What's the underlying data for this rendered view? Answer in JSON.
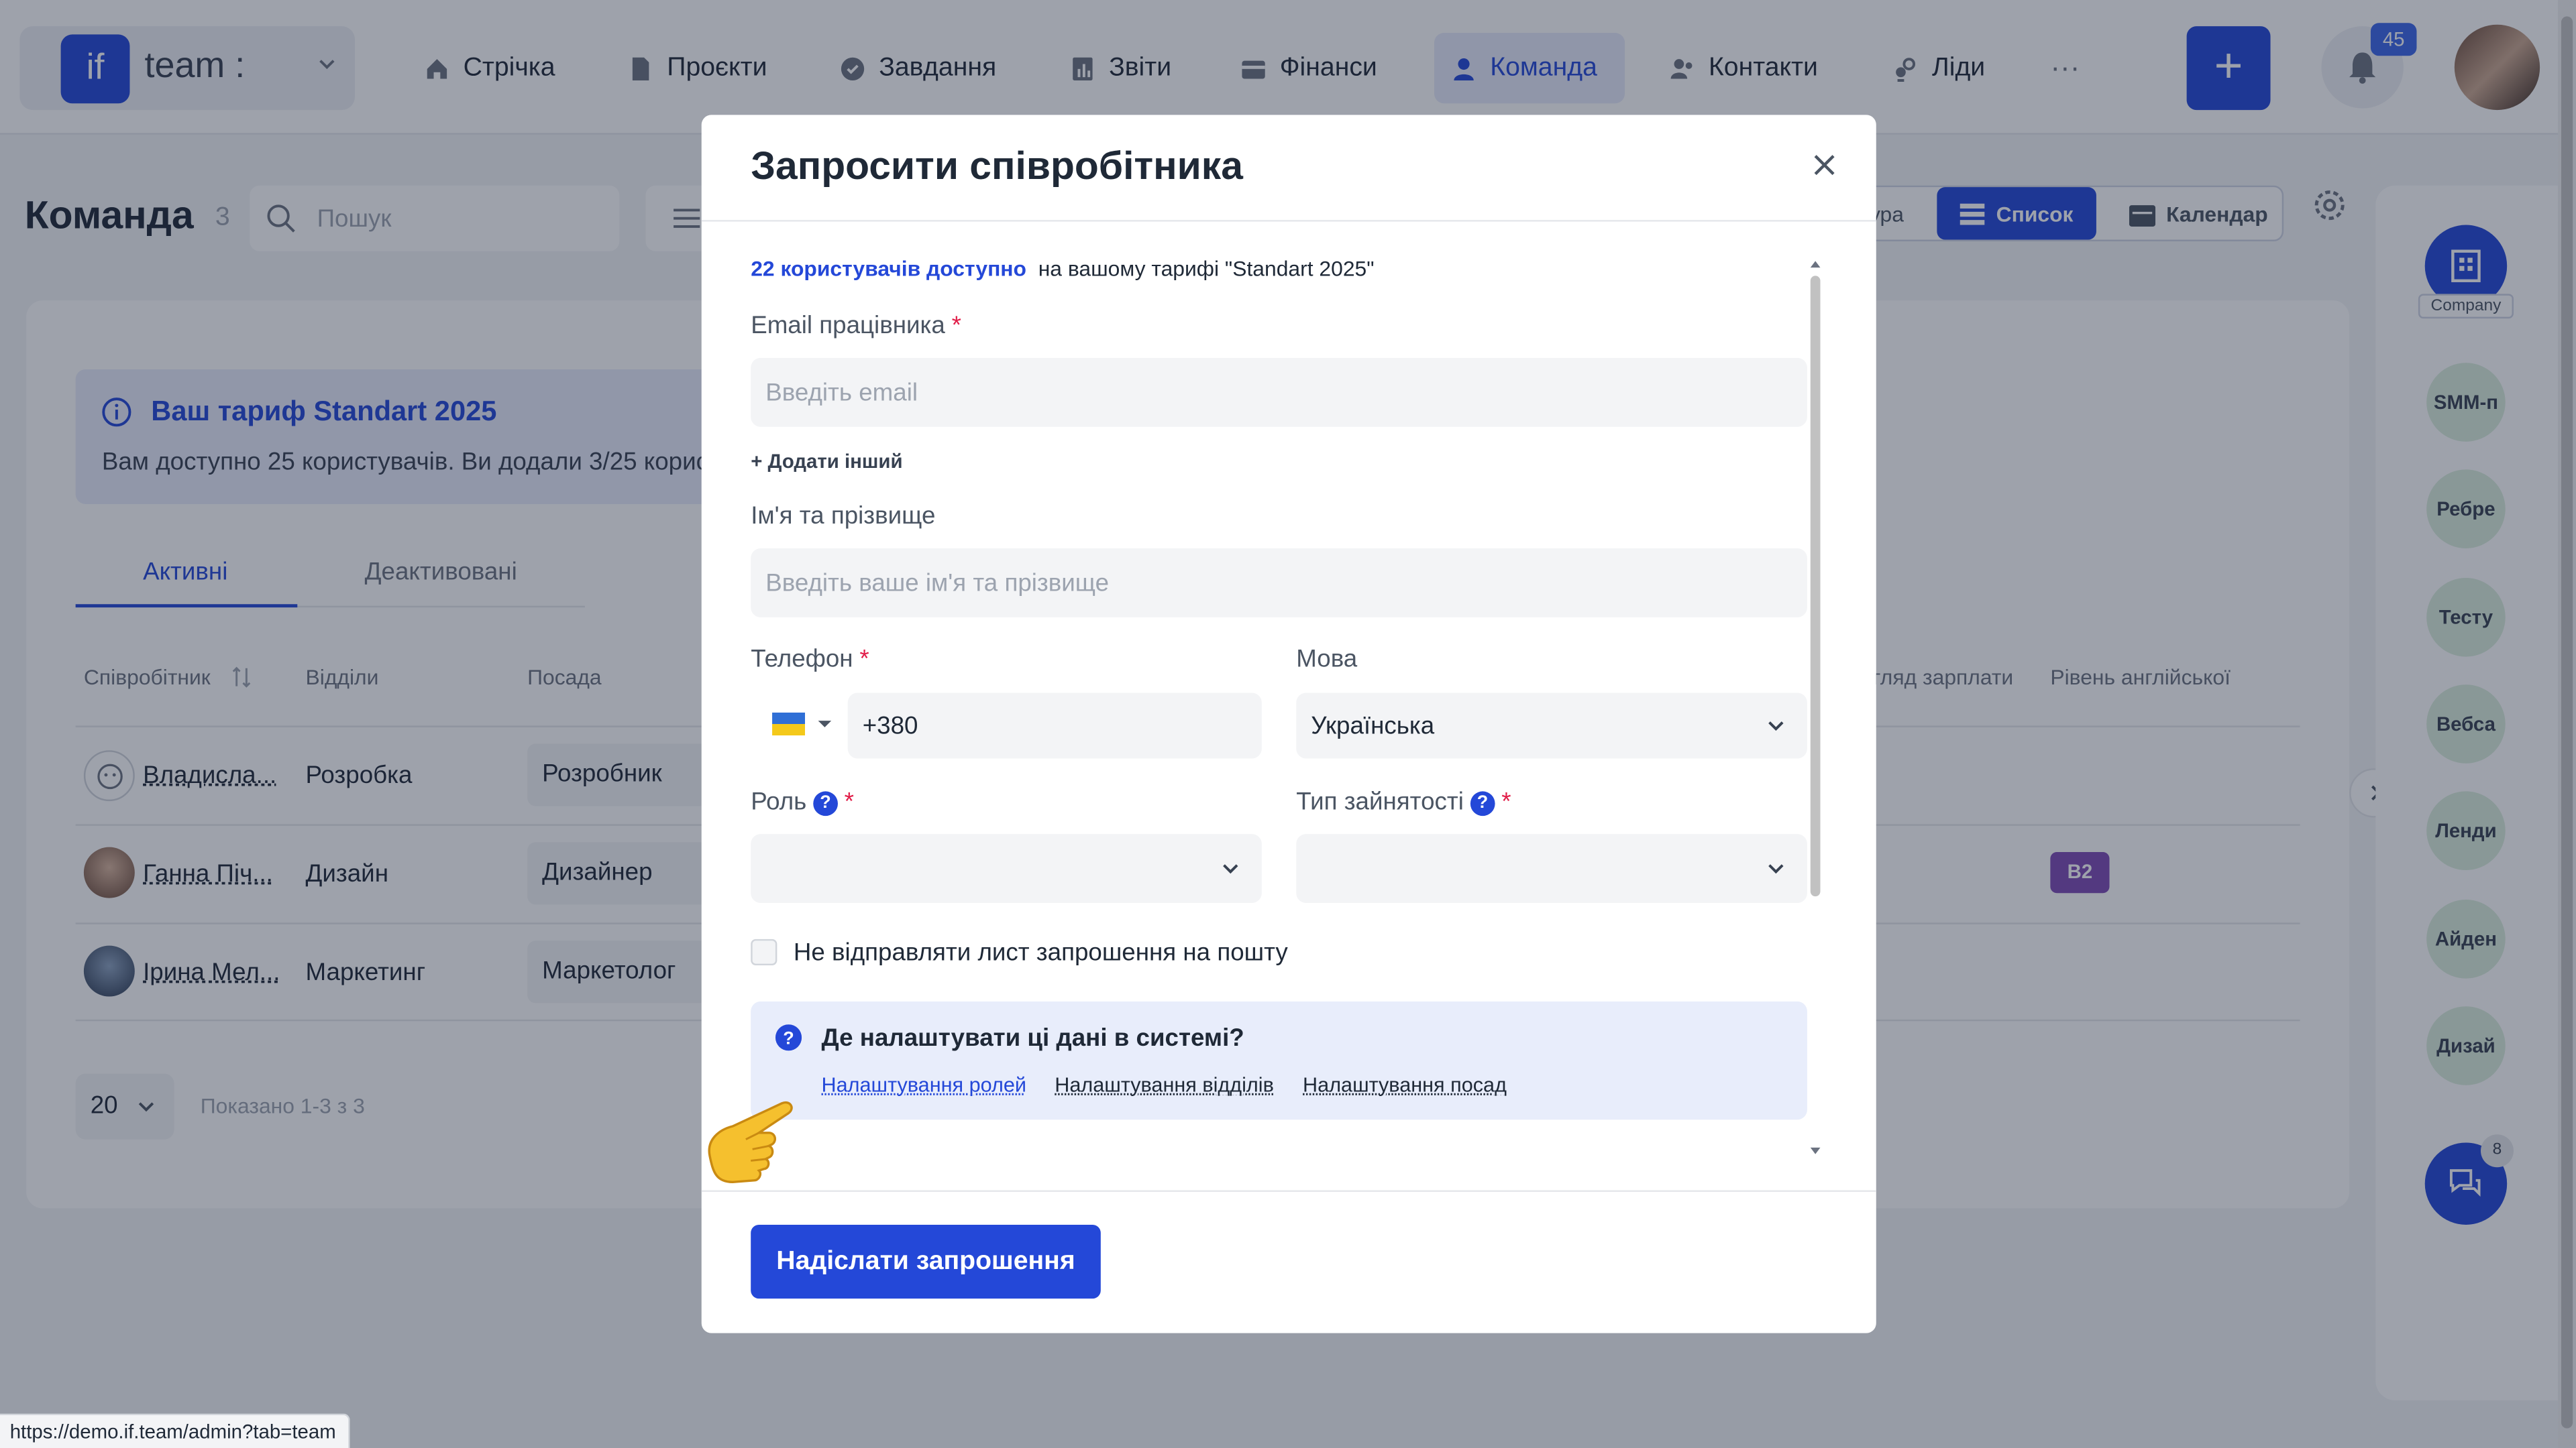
{
  "logo": {
    "mark": "if",
    "text": "team :"
  },
  "nav": [
    {
      "label": "Стрічка",
      "icon": "home-icon",
      "active": false
    },
    {
      "label": "Проєкти",
      "icon": "file-icon",
      "active": false
    },
    {
      "label": "Завдання",
      "icon": "check-circle-icon",
      "active": false
    },
    {
      "label": "Звіти",
      "icon": "report-icon",
      "active": false
    },
    {
      "label": "Фінанси",
      "icon": "wallet-icon",
      "active": false
    },
    {
      "label": "Команда",
      "icon": "user-icon",
      "active": true
    },
    {
      "label": "Контакти",
      "icon": "contacts-icon",
      "active": false
    },
    {
      "label": "Ліди",
      "icon": "leads-icon",
      "active": false
    }
  ],
  "nav_more": "···",
  "notifications_count": "45",
  "page": {
    "title": "Команда",
    "count": "3",
    "search_placeholder": "Пошук"
  },
  "view_modes": {
    "structure": "ура",
    "list": "Список",
    "calendar": "Календар"
  },
  "tariff": {
    "title": "Ваш тариф Standart 2025",
    "text": "Вам доступно 25 користувачів. Ви додали 3/25 корис"
  },
  "tabs": {
    "active": "Активні",
    "inactive": "Деактивовані"
  },
  "table": {
    "headers": {
      "employee": "Співробітник",
      "departments": "Відділи",
      "position": "Посада",
      "salary": "гляд зарплати",
      "english": "Рівень англійської"
    },
    "rows": [
      {
        "name": "Владисла...",
        "department": "Розробка",
        "position": "Розробник",
        "english": ""
      },
      {
        "name": "Ганна Піч...",
        "department": "Дизайн",
        "position": "Дизайнер",
        "english": "B2"
      },
      {
        "name": "Ірина Мел...",
        "department": "Маркетинг",
        "position": "Маркетолог",
        "english": ""
      }
    ]
  },
  "pagination": {
    "page_size": "20",
    "info": "Показано 1-3 з 3"
  },
  "right_panel": {
    "company_label": "Company",
    "items": [
      "SMM-п",
      "Ребре",
      "Тесту",
      "Вебса",
      "Ленди",
      "Айден",
      "Дизай"
    ],
    "chat_badge": "8"
  },
  "modal": {
    "title": "Запросити співробітника",
    "available_count": "22 користувачів доступно",
    "available_text": "на вашому тарифі \"Standart 2025\"",
    "email_label": "Email працівника",
    "email_placeholder": "Введіть email",
    "add_other": "+ Додати інший",
    "name_label": "Ім'я та прізвище",
    "name_placeholder": "Введіть ваше ім'я та прізвище",
    "phone_label": "Телефон",
    "phone_value": "+380",
    "language_label": "Мова",
    "language_value": "Українська",
    "role_label": "Роль",
    "employment_label": "Тип зайнятості",
    "checkbox_label": "Не відправляти лист запрошення на пошту",
    "info_title": "Де налаштувати ці дані в системі?",
    "info_links": [
      "Налаштування ролей",
      "Налаштування відділів",
      "Налаштування посад"
    ],
    "submit": "Надіслати запрошення"
  },
  "status_url": "https://demo.if.team/admin?tab=team",
  "colors": {
    "accent": "#2448d8",
    "badge_b2": "#7e4bb6",
    "overlay": "rgba(25,33,56,0.42)"
  }
}
